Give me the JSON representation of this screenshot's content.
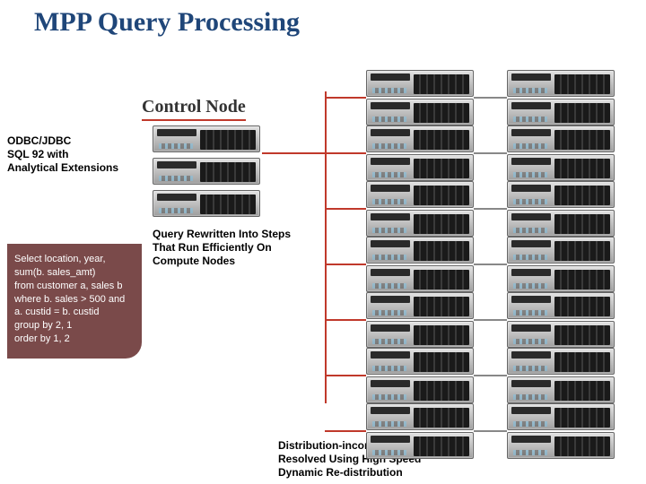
{
  "title": "MPP Query Processing",
  "section_label": "Control Node",
  "odbc": {
    "line1": "ODBC/JDBC",
    "line2": "SQL 92 with",
    "line3": "Analytical Extensions"
  },
  "query": {
    "line1": "Select location, year,",
    "line2": "sum(b. sales_amt)",
    "line3": "from customer a, sales b",
    "line4": "where b. sales > 500 and",
    "line5": "a. custid = b. custid",
    "line6": "group by 2, 1",
    "line7": "order by 1, 2"
  },
  "notes": {
    "rewrite": {
      "line1": "Query Rewritten Into Steps",
      "line2": "That Run Efficiently On",
      "line3": "Compute Nodes"
    },
    "dist": {
      "line1": "Distribution-incompatible Joins",
      "line2": "Resolved Using High Speed",
      "line3": "Dynamic Re-distribution"
    }
  },
  "layout": {
    "control_stack_count": 3,
    "compute_columns": 2,
    "compute_groups_per_column": 7,
    "servers_per_group": 2
  }
}
